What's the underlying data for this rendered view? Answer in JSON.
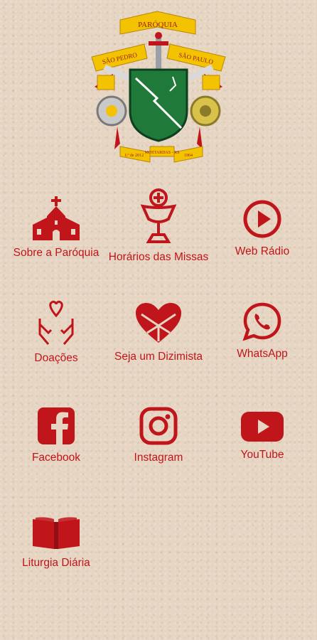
{
  "header": {
    "crest": {
      "banner_top": "PARÓQUIA",
      "banner_left": "SÃO PEDRO",
      "banner_right": "SÃO PAULO",
      "ribbon_left": "Lº de 2012",
      "ribbon_center": "MOSTARDAS - RS",
      "ribbon_right": "1964"
    }
  },
  "colors": {
    "accent": "#c0151b",
    "background": "#e6d5c2"
  },
  "menu": [
    {
      "label": "Sobre a Paróquia",
      "icon": "church-icon"
    },
    {
      "label": "Horários das Missas",
      "icon": "chalice-icon"
    },
    {
      "label": "Web Rádio",
      "icon": "play-circle-icon"
    },
    {
      "label": "Doações",
      "icon": "heart-hands-icon"
    },
    {
      "label": "Seja um Dizimista",
      "icon": "heart-icon"
    },
    {
      "label": "WhatsApp",
      "icon": "whatsapp-icon"
    },
    {
      "label": "Facebook",
      "icon": "facebook-icon"
    },
    {
      "label": "Instagram",
      "icon": "instagram-icon"
    },
    {
      "label": "YouTube",
      "icon": "youtube-icon"
    },
    {
      "label": "Liturgia Diária",
      "icon": "bible-icon"
    }
  ]
}
